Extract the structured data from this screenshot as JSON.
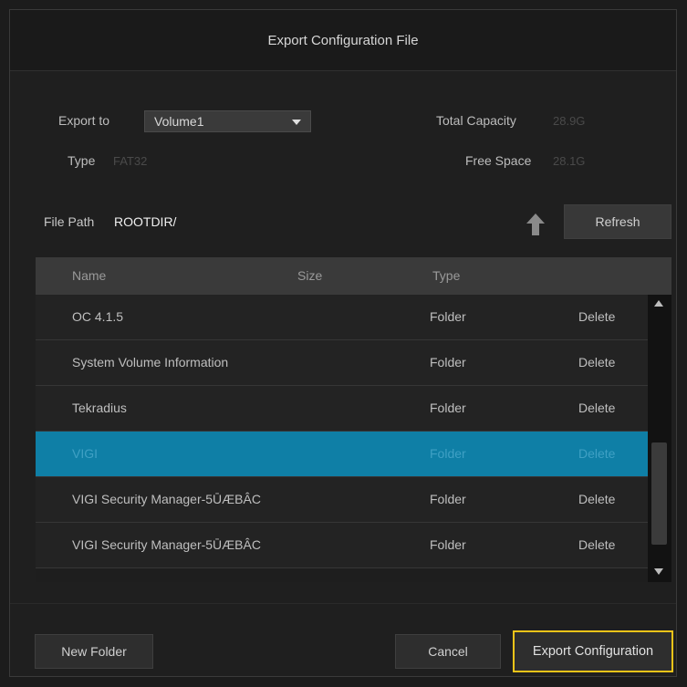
{
  "dialog": {
    "title": "Export Configuration File"
  },
  "export": {
    "export_to_label": "Export to",
    "volume_value": "Volume1",
    "type_label": "Type",
    "type_value": "FAT32",
    "total_capacity_label": "Total Capacity",
    "total_capacity_value": "28.9G",
    "free_space_label": "Free Space",
    "free_space_value": "28.1G"
  },
  "path": {
    "label": "File Path",
    "value": "ROOTDIR/",
    "refresh_label": "Refresh"
  },
  "table": {
    "headers": {
      "name": "Name",
      "size": "Size",
      "type": "Type"
    },
    "rows": [
      {
        "name": "OC 4.1.5",
        "type": "Folder",
        "action": "Delete"
      },
      {
        "name": "System Volume Information",
        "type": "Folder",
        "action": "Delete"
      },
      {
        "name": "Tekradius",
        "type": "Folder",
        "action": "Delete"
      },
      {
        "name": "VIGI",
        "type": "Folder",
        "action": "Delete"
      },
      {
        "name": "VIGI Security Manager-5ŪÆBÂC",
        "type": "Folder",
        "action": "Delete"
      },
      {
        "name": "VIGI Security Manager-5ŪÆBÂC",
        "type": "Folder",
        "action": "Delete"
      }
    ]
  },
  "footer": {
    "new_folder_label": "New Folder",
    "cancel_label": "Cancel",
    "export_label": "Export Configuration"
  },
  "colors": {
    "selected_row": "#0f7fa6",
    "focus_outline": "#f0c419"
  }
}
